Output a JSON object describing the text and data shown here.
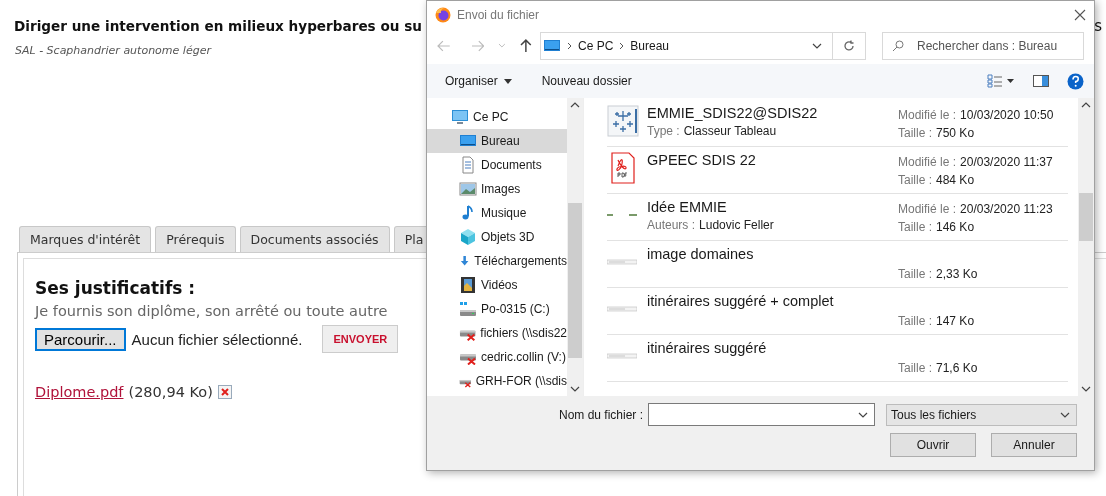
{
  "page": {
    "title": "Diriger une intervention en milieux hyperbares ou su",
    "title_tail": "s",
    "subtitle": "SAL - Scaphandrier autonome léger",
    "tabs": [
      {
        "label": "Marques d'intérêt",
        "selected": false
      },
      {
        "label": "Prérequis",
        "selected": false
      },
      {
        "label": "Documents associés",
        "selected": false
      },
      {
        "label": "Pla",
        "selected": false
      }
    ],
    "section_title": "Ses justificatifs :",
    "instructions": "Je fournis son diplôme, son arrêté ou toute autre",
    "browse_button": "Parcourir...",
    "no_file": "Aucun fichier sélectionné.",
    "send_button": "ENVOYER",
    "attachment": {
      "name": "Diplome.pdf",
      "size": "(280,94 Ko)"
    }
  },
  "dialog": {
    "title": "Envoi du fichier",
    "breadcrumb": [
      "Ce PC",
      "Bureau"
    ],
    "search": {
      "placeholder": "Rechercher dans : Bureau"
    },
    "toolbar": [
      "Organiser",
      "Nouveau dossier"
    ],
    "nav": [
      {
        "label": "Ce PC",
        "kind": "pc",
        "selected": false,
        "children": [
          {
            "label": "Bureau",
            "kind": "desktop",
            "selected": true
          },
          {
            "label": "Documents",
            "kind": "documents",
            "selected": false
          },
          {
            "label": "Images",
            "kind": "images",
            "selected": false
          },
          {
            "label": "Musique",
            "kind": "music",
            "selected": false
          },
          {
            "label": "Objets 3D",
            "kind": "cube",
            "selected": false
          },
          {
            "label": "Téléchargements",
            "kind": "download",
            "selected": false
          },
          {
            "label": "Vidéos",
            "kind": "video",
            "selected": false
          },
          {
            "label": "Po-0315 (C:)",
            "kind": "drive",
            "selected": false
          },
          {
            "label": "fichiers (\\\\sdis22",
            "kind": "netdrive",
            "selected": false
          },
          {
            "label": "cedric.collin (V:)",
            "kind": "netdrive",
            "selected": false
          },
          {
            "label": "GRH-FOR (\\\\sdis",
            "kind": "netdrive",
            "selected": false
          }
        ]
      }
    ],
    "files": [
      {
        "name": "EMMIE_SDIS22@SDIS22",
        "kind": "workbook",
        "detail": {
          "label": "Type :",
          "value": "Classeur Tableau"
        },
        "modified": {
          "label": "Modifié le :",
          "value": "10/03/2020 10:50"
        },
        "size": {
          "label": "Taille :",
          "value": "750 Ko"
        }
      },
      {
        "name": "GPEEC SDIS 22",
        "kind": "pdf",
        "modified": {
          "label": "Modifié le :",
          "value": "20/03/2020 11:37"
        },
        "size": {
          "label": "Taille :",
          "value": "484 Ko"
        }
      },
      {
        "name": "Idée EMMIE",
        "kind": "document",
        "detail": {
          "label": "Auteurs :",
          "value": "Ludovic Feller"
        },
        "modified": {
          "label": "Modifié le :",
          "value": "20/03/2020 11:23"
        },
        "size": {
          "label": "Taille :",
          "value": "146 Ko"
        }
      },
      {
        "name": "image domaines",
        "kind": "thumbnail",
        "size": {
          "label": "Taille :",
          "value": "2,33 Ko"
        }
      },
      {
        "name": "itinéraires suggéré + complet",
        "kind": "thumbnail",
        "size": {
          "label": "Taille :",
          "value": "147 Ko"
        }
      },
      {
        "name": "itinéraires suggéré",
        "kind": "thumbnail",
        "size": {
          "label": "Taille :",
          "value": "71,6 Ko"
        }
      }
    ],
    "filename_label": "Nom du fichier :",
    "filetype": "Tous les fichiers",
    "buttons": [
      "Ouvrir",
      "Annuler"
    ]
  }
}
